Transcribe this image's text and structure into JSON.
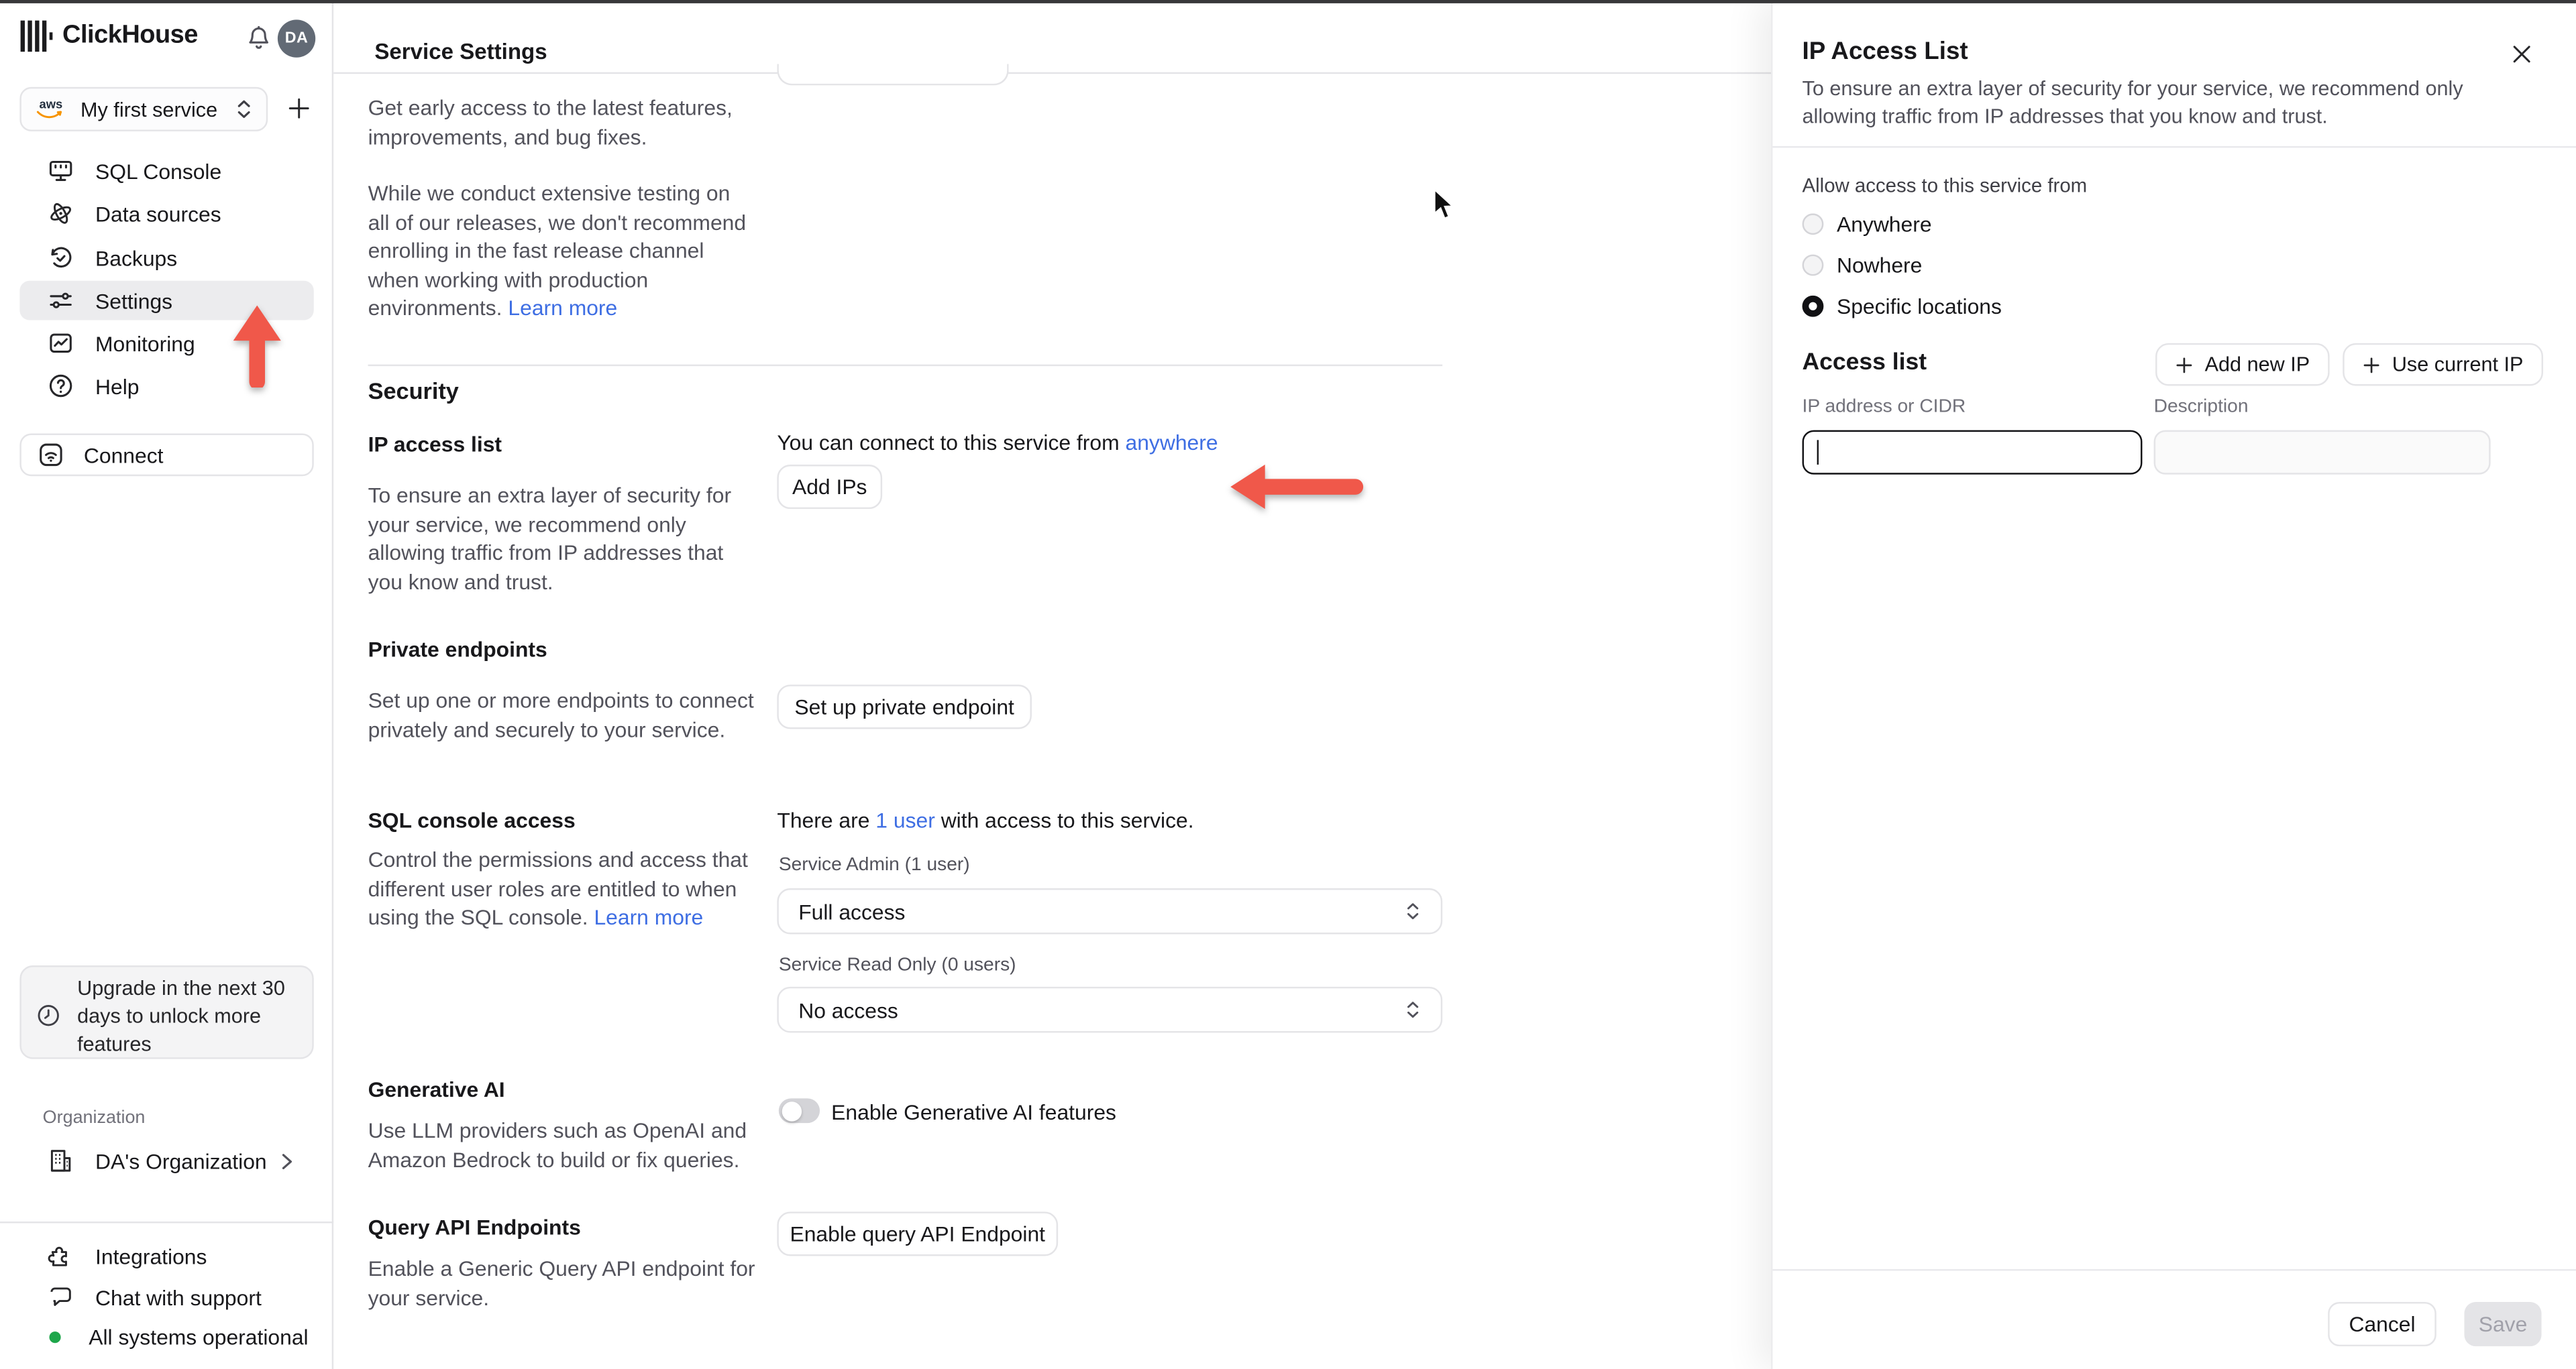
{
  "sidebar": {
    "brand": "ClickHouse",
    "avatar_initials": "DA",
    "service_selector": {
      "provider": "aws",
      "label": "My first service"
    },
    "nav": [
      {
        "label": "SQL Console"
      },
      {
        "label": "Data sources"
      },
      {
        "label": "Backups"
      },
      {
        "label": "Settings",
        "active": true
      },
      {
        "label": "Monitoring"
      },
      {
        "label": "Help"
      }
    ],
    "connect_label": "Connect",
    "upgrade_lines": [
      "Upgrade in the next 30",
      "days to unlock more",
      "features"
    ],
    "organization_label": "Organization",
    "organization_name": "DA's Organization",
    "integrations_label": "Integrations",
    "chat_label": "Chat with support",
    "status_label": "All systems operational"
  },
  "main": {
    "title": "Service Settings",
    "intro_para1_lines": [
      "Get early access to the latest features,",
      "improvements, and bug fixes."
    ],
    "intro_para2_lines": [
      "While we conduct extensive testing on",
      "all of our releases, we don't recommend",
      "enrolling in the fast release channel",
      "when working with production",
      "environments."
    ],
    "intro_learn_more": "Learn more",
    "security_heading": "Security",
    "ip_access": {
      "title": "IP access list",
      "desc_lines": [
        "To ensure an extra layer of security for",
        "your service, we recommend only",
        "allowing traffic from IP addresses that",
        "you know and trust."
      ],
      "status_prefix": "You can connect to this service from",
      "status_link": "anywhere",
      "add_ips_button": "Add IPs"
    },
    "private_endpoints": {
      "title": "Private endpoints",
      "desc_lines": [
        "Set up one or more endpoints to connect",
        "privately and securely to your service."
      ],
      "button": "Set up private endpoint"
    },
    "sql_console_access": {
      "title": "SQL console access",
      "desc_lines": [
        "Control the permissions and access that",
        "different user roles are entitled to when",
        "using the SQL console."
      ],
      "desc_link": "Learn more",
      "status_prefix": "There are",
      "status_link": "1 user",
      "status_suffix": "with access to this service.",
      "admin_label": "Service Admin (1 user)",
      "admin_value": "Full access",
      "readonly_label": "Service Read Only (0 users)",
      "readonly_value": "No access"
    },
    "generative_ai": {
      "title": "Generative AI",
      "desc_lines": [
        "Use LLM providers such as OpenAI and",
        "Amazon Bedrock to build or fix queries."
      ],
      "toggle_label": "Enable Generative AI features",
      "toggle_on": false
    },
    "query_api": {
      "title": "Query API Endpoints",
      "desc_lines": [
        "Enable a Generic Query API endpoint for",
        "your service."
      ],
      "button": "Enable query API Endpoint"
    }
  },
  "panel": {
    "title": "IP Access List",
    "desc_lines": [
      "To ensure an extra layer of security for your service, we recommend only",
      "allowing traffic from IP addresses that you know and trust."
    ],
    "allow_label": "Allow access to this service from",
    "options": [
      {
        "label": "Anywhere",
        "selected": false
      },
      {
        "label": "Nowhere",
        "selected": false
      },
      {
        "label": "Specific locations",
        "selected": true
      }
    ],
    "access_list_heading": "Access list",
    "add_new_ip_button": "Add new IP",
    "use_current_ip_button": "Use current IP",
    "ip_field": {
      "label": "IP address or CIDR",
      "value": ""
    },
    "description_field": {
      "label": "Description",
      "value": ""
    },
    "cancel_button": "Cancel",
    "save_button": "Save",
    "save_enabled": false
  },
  "colors": {
    "link": "#3e6ee3",
    "annotation_arrow": "#f0584a",
    "border": "#e4e4e7",
    "status_green": "#1ea64b"
  }
}
